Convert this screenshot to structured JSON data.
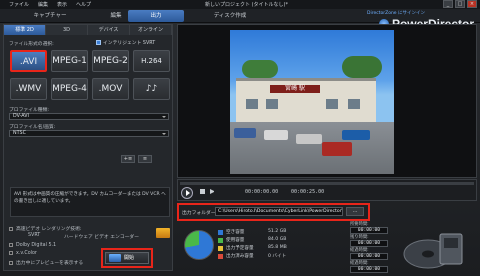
{
  "menu": {
    "file": "ファイル",
    "edit": "編集",
    "view": "表示",
    "help": "ヘルプ"
  },
  "window_title": "新しいプロジェクト (タイトルなし)*",
  "window_controls": {
    "minimize": "_",
    "maximize": "□",
    "close": "×"
  },
  "modes": [
    "キャプチャー",
    "編集",
    "出力",
    "ディスク作成"
  ],
  "active_mode_index": 2,
  "directorzone": "DirectorZone にサインイン",
  "brand": "PowerDirector",
  "output_tabs": [
    "標準 2D",
    "3D",
    "デバイス",
    "オンライン"
  ],
  "file_format_label": "ファイル形式の選択:",
  "intel_checkbox": "インテリジェント SVRT",
  "formats": [
    {
      "label": ".AVI",
      "selected": true
    },
    {
      "label": "MPEG-1",
      "selected": false
    },
    {
      "label": "MPEG-2",
      "selected": false
    },
    {
      "label": "H.264 AVC",
      "selected": false
    },
    {
      "label": ".WMV",
      "selected": false
    },
    {
      "label": "MPEG-4",
      "selected": false
    },
    {
      "label": ".MOV",
      "selected": false
    },
    {
      "label": "♪♪",
      "selected": false
    }
  ],
  "profile_type_label": "プロファイル種類:",
  "profile_type_value": "DV-AVI",
  "profile_name_label": "プロファイル名/画質:",
  "profile_name_value": "NTSC",
  "profile_buttons": [
    "+≡",
    "≡"
  ],
  "description": "AVI 形式は中画質の圧縮ができます。DV カムコーダーまたは DV VCR への書き出しに適しています。",
  "options": {
    "fast_render": "高速ビデオ レンダリング技術:",
    "svrt": "SVRT",
    "hw_encoder": "ハードウェア ビデオ エンコーダー",
    "dolby": "Dolby Digital 5.1",
    "xvcolor": "x.v.Color",
    "preview_during": "出力中にプレビューを表示する"
  },
  "start_button": "開始",
  "transport": {
    "time_a": "00:00:00.00",
    "time_b": "00:00:25.00"
  },
  "output_folder_label": "出力フォルダー:",
  "output_folder_path": "C:\\Users\\Hiroto.I\\Documents\\CyberLink\\PowerDirector\\10.0\\Productions",
  "browse_label": "...",
  "disk_stats": [
    {
      "name": "空き容量",
      "value": "51.2 GB",
      "color": "#2f78d6"
    },
    {
      "name": "使用容量",
      "value": "84.0 GB",
      "color": "#4ab84a"
    },
    {
      "name": "出力予定容量",
      "value": "85.8 MB",
      "color": "#e8c23a"
    },
    {
      "name": "出力済み容量",
      "value": "0 バイト",
      "color": "#d94a3a"
    }
  ],
  "time_boxes": [
    {
      "label": "所要時間:",
      "value": "00:00:00"
    },
    {
      "label": "残り時間:",
      "value": "00:00:00"
    },
    {
      "label": "経過時間:",
      "value": "00:00:00"
    },
    {
      "label": "経過時間:",
      "value": "00:00:00"
    }
  ],
  "scene_sign": "宮崎 駅"
}
